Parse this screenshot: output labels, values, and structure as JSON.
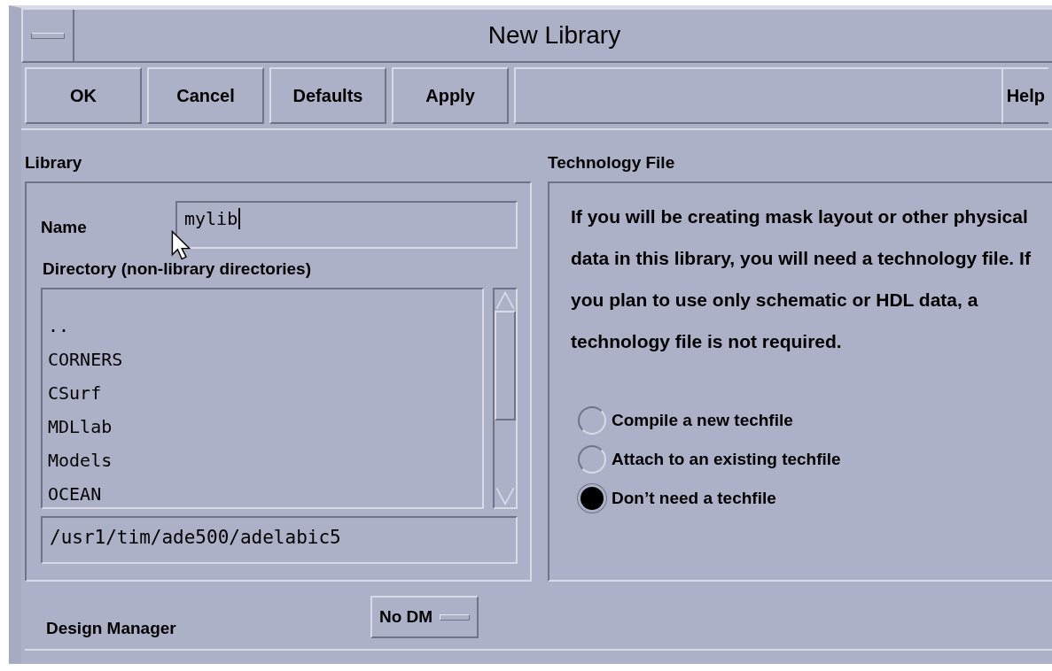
{
  "window": {
    "title": "New Library"
  },
  "buttons": [
    {
      "label": "OK"
    },
    {
      "label": "Cancel"
    },
    {
      "label": "Defaults"
    },
    {
      "label": "Apply"
    }
  ],
  "help_button": {
    "label": "Help"
  },
  "library": {
    "heading": "Library",
    "name_label": "Name",
    "name_value": "mylib",
    "directory_label": "Directory (non-library directories)",
    "directories": [
      {
        "label": "..",
        "selected": false
      },
      {
        "label": "CORNERS",
        "selected": false
      },
      {
        "label": "CSurf",
        "selected": false
      },
      {
        "label": "MDLlab",
        "selected": false
      },
      {
        "label": "Models",
        "selected": false
      },
      {
        "label": "OCEAN",
        "selected": false
      }
    ],
    "path_value": "/usr1/tim/ade500/adelabic5"
  },
  "technology_file": {
    "heading": "Technology File",
    "description": "If you will be creating mask layout or other physical data in this library, you will need a technology file. If you plan to use only schematic or HDL data, a technology file is not required.",
    "options": [
      {
        "label": "Compile a new techfile",
        "selected": false
      },
      {
        "label": "Attach to an existing techfile",
        "selected": false
      },
      {
        "label": "Don’t need a techfile",
        "selected": true
      }
    ]
  },
  "design_manager": {
    "label": "Design Manager",
    "value": "No DM"
  }
}
